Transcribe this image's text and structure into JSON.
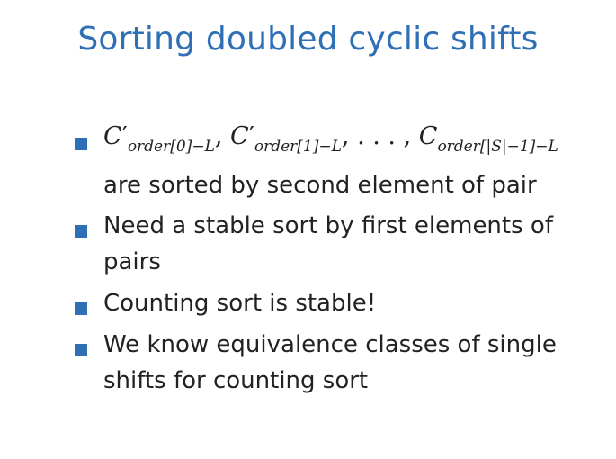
{
  "slide": {
    "title": "Sorting doubled cyclic shifts",
    "bullets": [
      {
        "math_terms": [
          {
            "base": "C",
            "prime": "′",
            "sub": "order[0]−L"
          },
          {
            "base": "C",
            "prime": "′",
            "sub": "order[1]−L"
          },
          {
            "base": "C",
            "prime": "",
            "sub": "order[|S|−1]−L"
          }
        ],
        "separator": ",",
        "ellipsis": ". . . ,",
        "text": "are sorted by second element of pair"
      },
      {
        "line1": "Need a stable sort by first elements of",
        "line2": "pairs"
      },
      {
        "line1": "Counting sort is stable!"
      },
      {
        "line1": "We know equivalence classes of single",
        "line2": "shifts for counting sort"
      }
    ]
  },
  "colors": {
    "accent": "#2e6fb5",
    "text": "#222222",
    "background": "#ffffff"
  },
  "icons": {
    "bullet": "square-bullet-icon"
  }
}
